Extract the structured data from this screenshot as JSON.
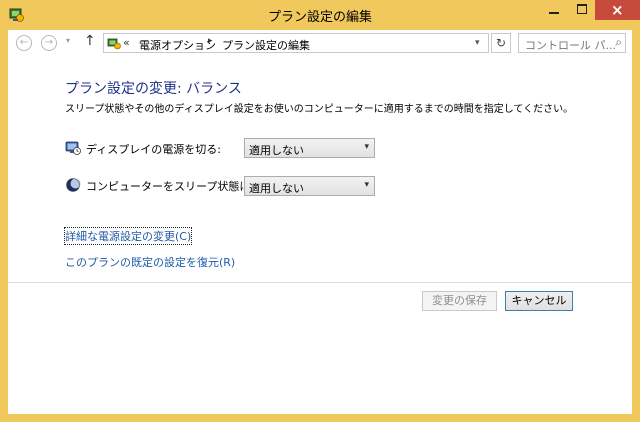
{
  "window": {
    "title": "プラン設定の編集",
    "close_glyph": "×",
    "icon": "power-options-icon"
  },
  "nav": {
    "back_glyph": "←",
    "forward_glyph": "→",
    "recent_glyph": "▾",
    "up_glyph": "↑",
    "address_icon": "power-options-icon",
    "breadcrumb_prefix": "«",
    "breadcrumb_separator": "▸",
    "breadcrumbs": [
      "電源オプション",
      "プラン設定の編集"
    ],
    "dropdown_glyph": "▾",
    "refresh_glyph": "↻",
    "search_placeholder": "コントロール パ...",
    "search_glyph": "⌕"
  },
  "main": {
    "heading": "プラン設定の変更: バランス",
    "description": "スリープ状態やその他のディスプレイ設定をお使いのコンピューターに適用するまでの時間を指定してください。",
    "settings": [
      {
        "label": "ディスプレイの電源を切る:",
        "value": "適用しない",
        "icon": "display-timer-icon"
      },
      {
        "label": "コンピューターをスリープ状態にする:",
        "value": "適用しない",
        "icon": "sleep-moon-icon"
      }
    ],
    "select_arrow": "▾",
    "links": {
      "advanced": "詳細な電源設定の変更(C)",
      "restore": "このプランの既定の設定を復元(R)"
    }
  },
  "footer": {
    "save_label": "変更の保存",
    "cancel_label": "キャンセル"
  },
  "colors": {
    "title_bar": "#f0c85c",
    "close_button": "#c74b3c",
    "heading": "#1e3287",
    "link": "#1e5aa8"
  }
}
